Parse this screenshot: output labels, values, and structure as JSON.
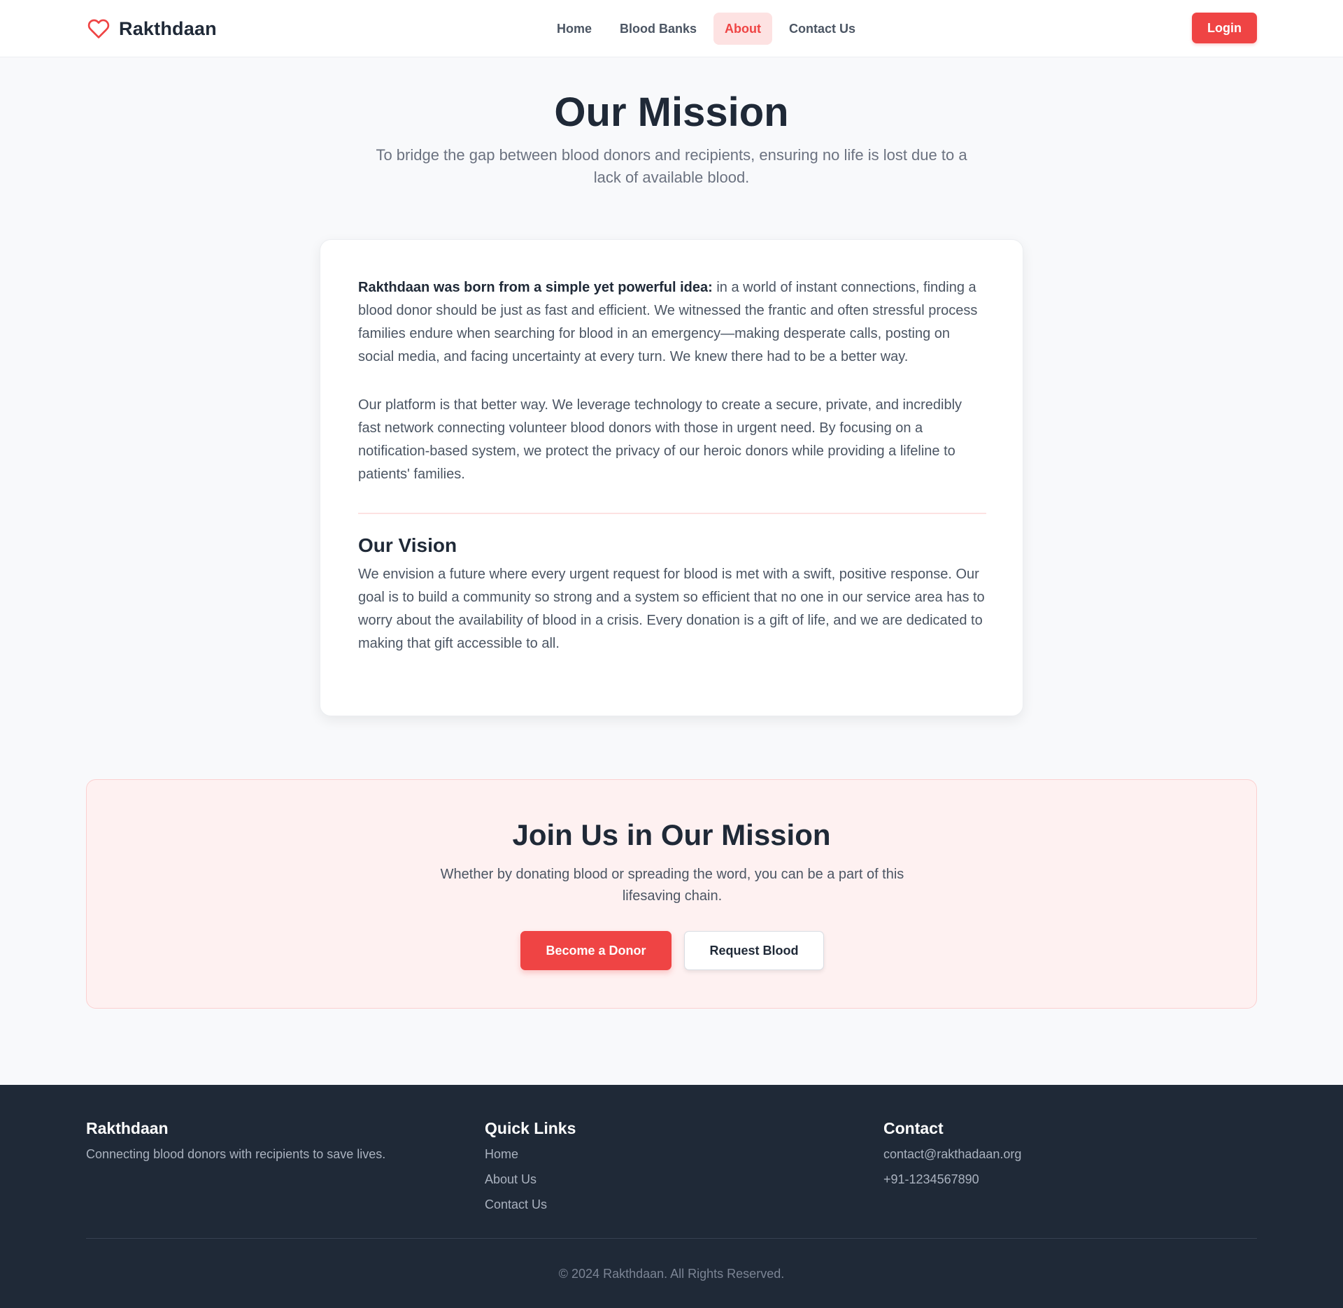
{
  "brand": {
    "name": "Rakthdaan",
    "icon": "heart-icon",
    "accent": "#ef4444"
  },
  "nav": {
    "items": [
      {
        "label": "Home",
        "active": false
      },
      {
        "label": "Blood Banks",
        "active": false
      },
      {
        "label": "About",
        "active": true
      },
      {
        "label": "Contact Us",
        "active": false
      }
    ],
    "login_label": "Login"
  },
  "hero": {
    "title": "Our Mission",
    "subtitle": "To bridge the gap between blood donors and recipients, ensuring no life is lost due to a lack of available blood."
  },
  "story": {
    "intro_bold": "Rakthdaan was born from a simple yet powerful idea:",
    "intro_rest": " in a world of instant connections, finding a blood donor should be just as fast and efficient. We witnessed the frantic and often stressful process families endure when searching for blood in an emergency—making desperate calls, posting on social media, and facing uncertainty at every turn. We knew there had to be a better way.",
    "platform": "Our platform is that better way. We leverage technology to create a secure, private, and incredibly fast network connecting volunteer blood donors with those in urgent need. By focusing on a notification-based system, we protect the privacy of our heroic donors while providing a lifeline to patients' families.",
    "vision_title": "Our Vision",
    "vision_text": "We envision a future where every urgent request for blood is met with a swift, positive response. Our goal is to build a community so strong and a system so efficient that no one in our service area has to worry about the availability of blood in a crisis. Every donation is a gift of life, and we are dedicated to making that gift accessible to all."
  },
  "join": {
    "title": "Join Us in Our Mission",
    "subtitle": "Whether by donating blood or spreading the word, you can be a part of this lifesaving chain.",
    "donor_label": "Become a Donor",
    "request_label": "Request Blood"
  },
  "footer": {
    "about": {
      "title": "Rakthdaan",
      "text": "Connecting blood donors with recipients to save lives."
    },
    "links": {
      "title": "Quick Links",
      "items": [
        "Home",
        "About Us",
        "Contact Us"
      ]
    },
    "contact": {
      "title": "Contact",
      "email": "contact@rakthadaan.org",
      "phone": "+91-1234567890"
    },
    "copyright": "© 2024 Rakthdaan. All Rights Reserved."
  }
}
